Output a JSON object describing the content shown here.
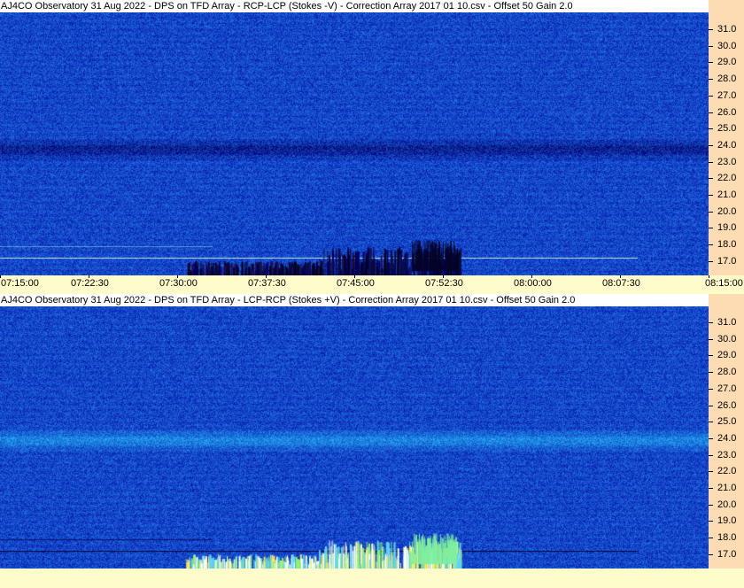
{
  "panels": [
    {
      "title": "AJ4CO Observatory 31 Aug 2022  -  DPS on TFD Array  -  RCP-LCP (Stokes -V)  -  Correction Array 2017 01 10.csv  -  Offset 50  Gain 2.0",
      "polarity": "negative"
    },
    {
      "title": "AJ4CO Observatory 31 Aug 2022  -  DPS on TFD Array  -  LCP-RCP (Stokes +V)  -  Correction Array 2017 01 10.csv  -  Offset 50  Gain 2.0",
      "polarity": "positive"
    }
  ],
  "freq_labels": [
    "31.0",
    "30.0",
    "29.0",
    "28.0",
    "27.0",
    "26.0",
    "25.0",
    "24.0",
    "23.0",
    "22.0",
    "21.0",
    "20.0",
    "19.0",
    "18.0",
    "17.0"
  ],
  "time_labels": [
    "07:15:00",
    "07:22:30",
    "07:30:00",
    "07:37:30",
    "07:45:00",
    "07:52:30",
    "08:00:00",
    "08:07:30",
    "08:15:00"
  ],
  "colors": {
    "background": "#0a3cc8",
    "scale_bg": "#fddcb4",
    "axis_bg": "#fffccc"
  }
}
